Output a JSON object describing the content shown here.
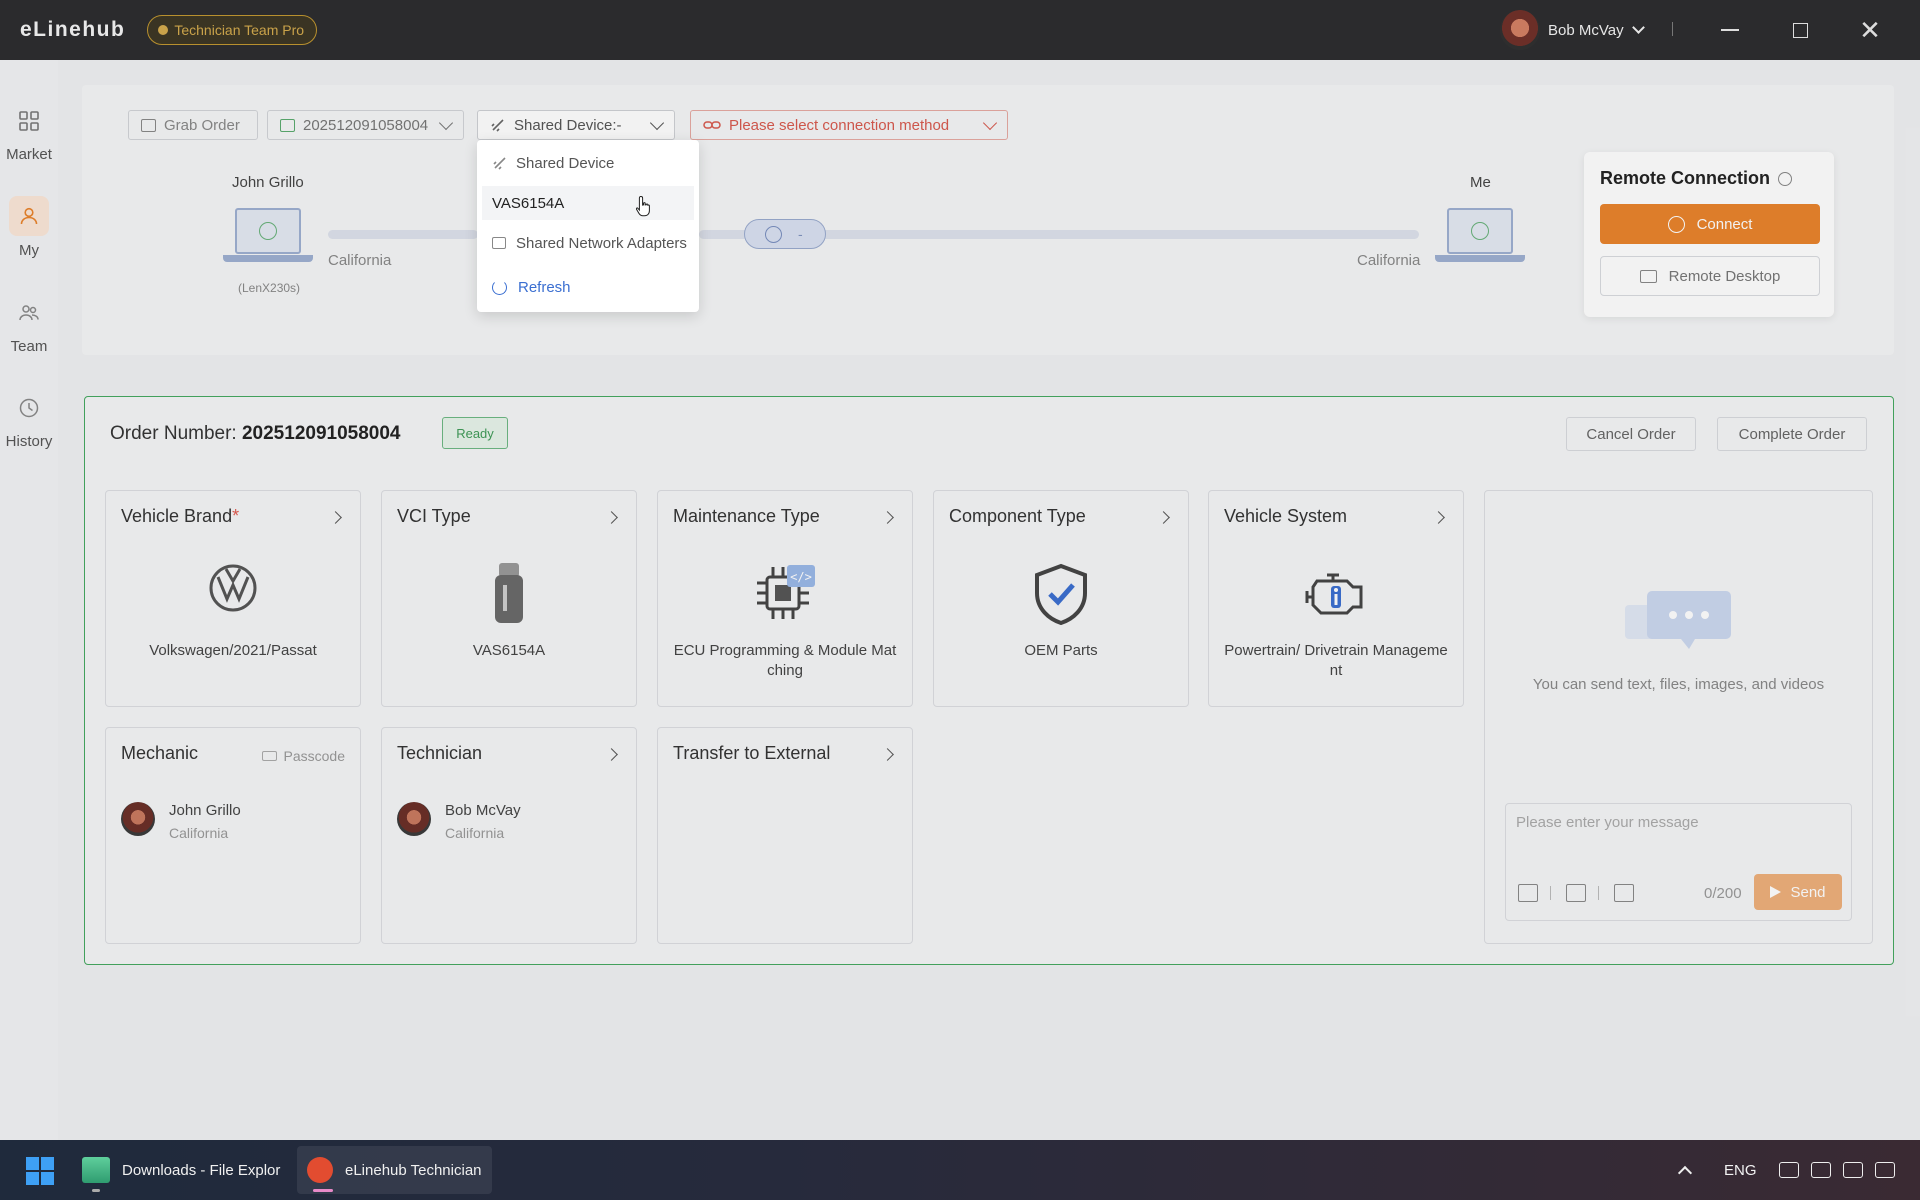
{
  "app": {
    "title": "eLinehub",
    "badge": "Technician Team Pro"
  },
  "user": {
    "name": "Bob McVay"
  },
  "sidebar": {
    "items": [
      {
        "label": "Market",
        "icon": "grid-icon"
      },
      {
        "label": "My",
        "icon": "user-icon"
      },
      {
        "label": "Team",
        "icon": "team-icon"
      },
      {
        "label": "History",
        "icon": "history-icon"
      }
    ]
  },
  "toolbar": {
    "grab_order": "Grab Order",
    "order_select": "202512091058004",
    "shared_device": "Shared Device:-",
    "connection_method": "Please select connection method"
  },
  "dropdown": {
    "items": [
      {
        "label": "Shared Device",
        "icon": "link-icon"
      },
      {
        "label": "VAS6154A"
      },
      {
        "label": "Shared Network Adapters",
        "icon": "network-adapter-icon"
      },
      {
        "label": "Refresh",
        "icon": "refresh-icon"
      }
    ]
  },
  "connection": {
    "left_name": "John Grillo",
    "left_location": "California",
    "left_device": "(LenX230s)",
    "center_label": "-",
    "right_name": "Me",
    "right_location": "California"
  },
  "remote": {
    "title": "Remote Connection",
    "connect": "Connect",
    "remote_desktop": "Remote Desktop"
  },
  "order": {
    "label": "Order Number:",
    "number": "202512091058004",
    "status": "Ready",
    "cancel": "Cancel Order",
    "complete": "Complete Order"
  },
  "cards": {
    "vehicle_brand": {
      "title": "Vehicle Brand",
      "required": "*",
      "value": "Volkswagen/2021/Passat"
    },
    "vci_type": {
      "title": "VCI Type",
      "value": "VAS6154A"
    },
    "maintenance_type": {
      "title": "Maintenance Type",
      "value": "ECU Programming & Module Mat ching"
    },
    "component_type": {
      "title": "Component Type",
      "value": "OEM Parts"
    },
    "vehicle_system": {
      "title": "Vehicle System",
      "value": "Powertrain/ Drivetrain Manageme nt"
    },
    "mechanic": {
      "title": "Mechanic",
      "passcode": "Passcode",
      "name": "John Grillo",
      "location": "California"
    },
    "technician": {
      "title": "Technician",
      "name": "Bob McVay",
      "location": "California"
    },
    "transfer": {
      "title": "Transfer to External"
    }
  },
  "chat": {
    "hint": "You can send text, files, images, and videos",
    "placeholder": "Please enter your message",
    "count": "0/200",
    "send": "Send"
  },
  "taskbar": {
    "apps": [
      {
        "label": "Downloads - File Explor"
      },
      {
        "label": "eLinehub Technician"
      }
    ],
    "language": "ENG"
  },
  "colors": {
    "accent": "#e9832b",
    "success": "#45a860",
    "error": "#d85a4e",
    "link": "#3b6fd1"
  }
}
